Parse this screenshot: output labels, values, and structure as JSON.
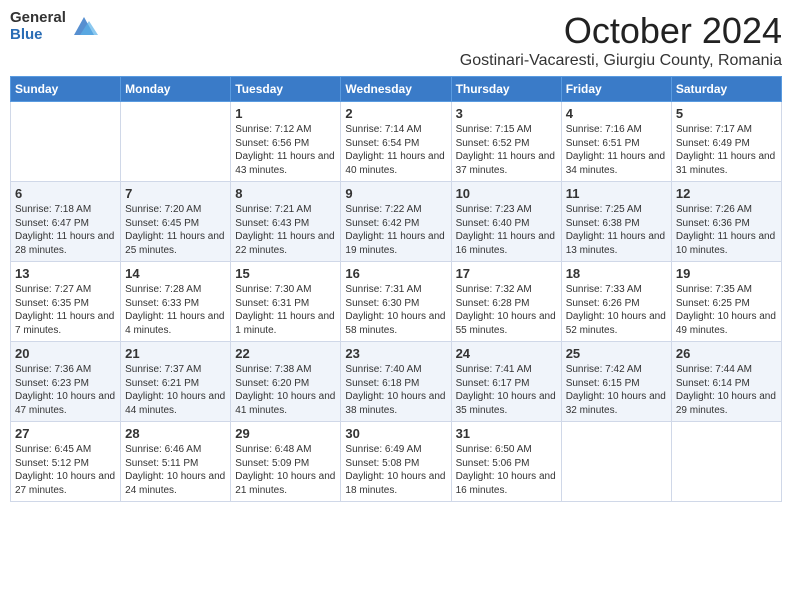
{
  "header": {
    "logo_general": "General",
    "logo_blue": "Blue",
    "month_title": "October 2024",
    "location": "Gostinari-Vacaresti, Giurgiu County, Romania"
  },
  "weekdays": [
    "Sunday",
    "Monday",
    "Tuesday",
    "Wednesday",
    "Thursday",
    "Friday",
    "Saturday"
  ],
  "weeks": [
    [
      {
        "day": "",
        "lines": []
      },
      {
        "day": "",
        "lines": []
      },
      {
        "day": "1",
        "lines": [
          "Sunrise: 7:12 AM",
          "Sunset: 6:56 PM",
          "Daylight: 11 hours and 43 minutes."
        ]
      },
      {
        "day": "2",
        "lines": [
          "Sunrise: 7:14 AM",
          "Sunset: 6:54 PM",
          "Daylight: 11 hours and 40 minutes."
        ]
      },
      {
        "day": "3",
        "lines": [
          "Sunrise: 7:15 AM",
          "Sunset: 6:52 PM",
          "Daylight: 11 hours and 37 minutes."
        ]
      },
      {
        "day": "4",
        "lines": [
          "Sunrise: 7:16 AM",
          "Sunset: 6:51 PM",
          "Daylight: 11 hours and 34 minutes."
        ]
      },
      {
        "day": "5",
        "lines": [
          "Sunrise: 7:17 AM",
          "Sunset: 6:49 PM",
          "Daylight: 11 hours and 31 minutes."
        ]
      }
    ],
    [
      {
        "day": "6",
        "lines": [
          "Sunrise: 7:18 AM",
          "Sunset: 6:47 PM",
          "Daylight: 11 hours and 28 minutes."
        ]
      },
      {
        "day": "7",
        "lines": [
          "Sunrise: 7:20 AM",
          "Sunset: 6:45 PM",
          "Daylight: 11 hours and 25 minutes."
        ]
      },
      {
        "day": "8",
        "lines": [
          "Sunrise: 7:21 AM",
          "Sunset: 6:43 PM",
          "Daylight: 11 hours and 22 minutes."
        ]
      },
      {
        "day": "9",
        "lines": [
          "Sunrise: 7:22 AM",
          "Sunset: 6:42 PM",
          "Daylight: 11 hours and 19 minutes."
        ]
      },
      {
        "day": "10",
        "lines": [
          "Sunrise: 7:23 AM",
          "Sunset: 6:40 PM",
          "Daylight: 11 hours and 16 minutes."
        ]
      },
      {
        "day": "11",
        "lines": [
          "Sunrise: 7:25 AM",
          "Sunset: 6:38 PM",
          "Daylight: 11 hours and 13 minutes."
        ]
      },
      {
        "day": "12",
        "lines": [
          "Sunrise: 7:26 AM",
          "Sunset: 6:36 PM",
          "Daylight: 11 hours and 10 minutes."
        ]
      }
    ],
    [
      {
        "day": "13",
        "lines": [
          "Sunrise: 7:27 AM",
          "Sunset: 6:35 PM",
          "Daylight: 11 hours and 7 minutes."
        ]
      },
      {
        "day": "14",
        "lines": [
          "Sunrise: 7:28 AM",
          "Sunset: 6:33 PM",
          "Daylight: 11 hours and 4 minutes."
        ]
      },
      {
        "day": "15",
        "lines": [
          "Sunrise: 7:30 AM",
          "Sunset: 6:31 PM",
          "Daylight: 11 hours and 1 minute."
        ]
      },
      {
        "day": "16",
        "lines": [
          "Sunrise: 7:31 AM",
          "Sunset: 6:30 PM",
          "Daylight: 10 hours and 58 minutes."
        ]
      },
      {
        "day": "17",
        "lines": [
          "Sunrise: 7:32 AM",
          "Sunset: 6:28 PM",
          "Daylight: 10 hours and 55 minutes."
        ]
      },
      {
        "day": "18",
        "lines": [
          "Sunrise: 7:33 AM",
          "Sunset: 6:26 PM",
          "Daylight: 10 hours and 52 minutes."
        ]
      },
      {
        "day": "19",
        "lines": [
          "Sunrise: 7:35 AM",
          "Sunset: 6:25 PM",
          "Daylight: 10 hours and 49 minutes."
        ]
      }
    ],
    [
      {
        "day": "20",
        "lines": [
          "Sunrise: 7:36 AM",
          "Sunset: 6:23 PM",
          "Daylight: 10 hours and 47 minutes."
        ]
      },
      {
        "day": "21",
        "lines": [
          "Sunrise: 7:37 AM",
          "Sunset: 6:21 PM",
          "Daylight: 10 hours and 44 minutes."
        ]
      },
      {
        "day": "22",
        "lines": [
          "Sunrise: 7:38 AM",
          "Sunset: 6:20 PM",
          "Daylight: 10 hours and 41 minutes."
        ]
      },
      {
        "day": "23",
        "lines": [
          "Sunrise: 7:40 AM",
          "Sunset: 6:18 PM",
          "Daylight: 10 hours and 38 minutes."
        ]
      },
      {
        "day": "24",
        "lines": [
          "Sunrise: 7:41 AM",
          "Sunset: 6:17 PM",
          "Daylight: 10 hours and 35 minutes."
        ]
      },
      {
        "day": "25",
        "lines": [
          "Sunrise: 7:42 AM",
          "Sunset: 6:15 PM",
          "Daylight: 10 hours and 32 minutes."
        ]
      },
      {
        "day": "26",
        "lines": [
          "Sunrise: 7:44 AM",
          "Sunset: 6:14 PM",
          "Daylight: 10 hours and 29 minutes."
        ]
      }
    ],
    [
      {
        "day": "27",
        "lines": [
          "Sunrise: 6:45 AM",
          "Sunset: 5:12 PM",
          "Daylight: 10 hours and 27 minutes."
        ]
      },
      {
        "day": "28",
        "lines": [
          "Sunrise: 6:46 AM",
          "Sunset: 5:11 PM",
          "Daylight: 10 hours and 24 minutes."
        ]
      },
      {
        "day": "29",
        "lines": [
          "Sunrise: 6:48 AM",
          "Sunset: 5:09 PM",
          "Daylight: 10 hours and 21 minutes."
        ]
      },
      {
        "day": "30",
        "lines": [
          "Sunrise: 6:49 AM",
          "Sunset: 5:08 PM",
          "Daylight: 10 hours and 18 minutes."
        ]
      },
      {
        "day": "31",
        "lines": [
          "Sunrise: 6:50 AM",
          "Sunset: 5:06 PM",
          "Daylight: 10 hours and 16 minutes."
        ]
      },
      {
        "day": "",
        "lines": []
      },
      {
        "day": "",
        "lines": []
      }
    ]
  ]
}
